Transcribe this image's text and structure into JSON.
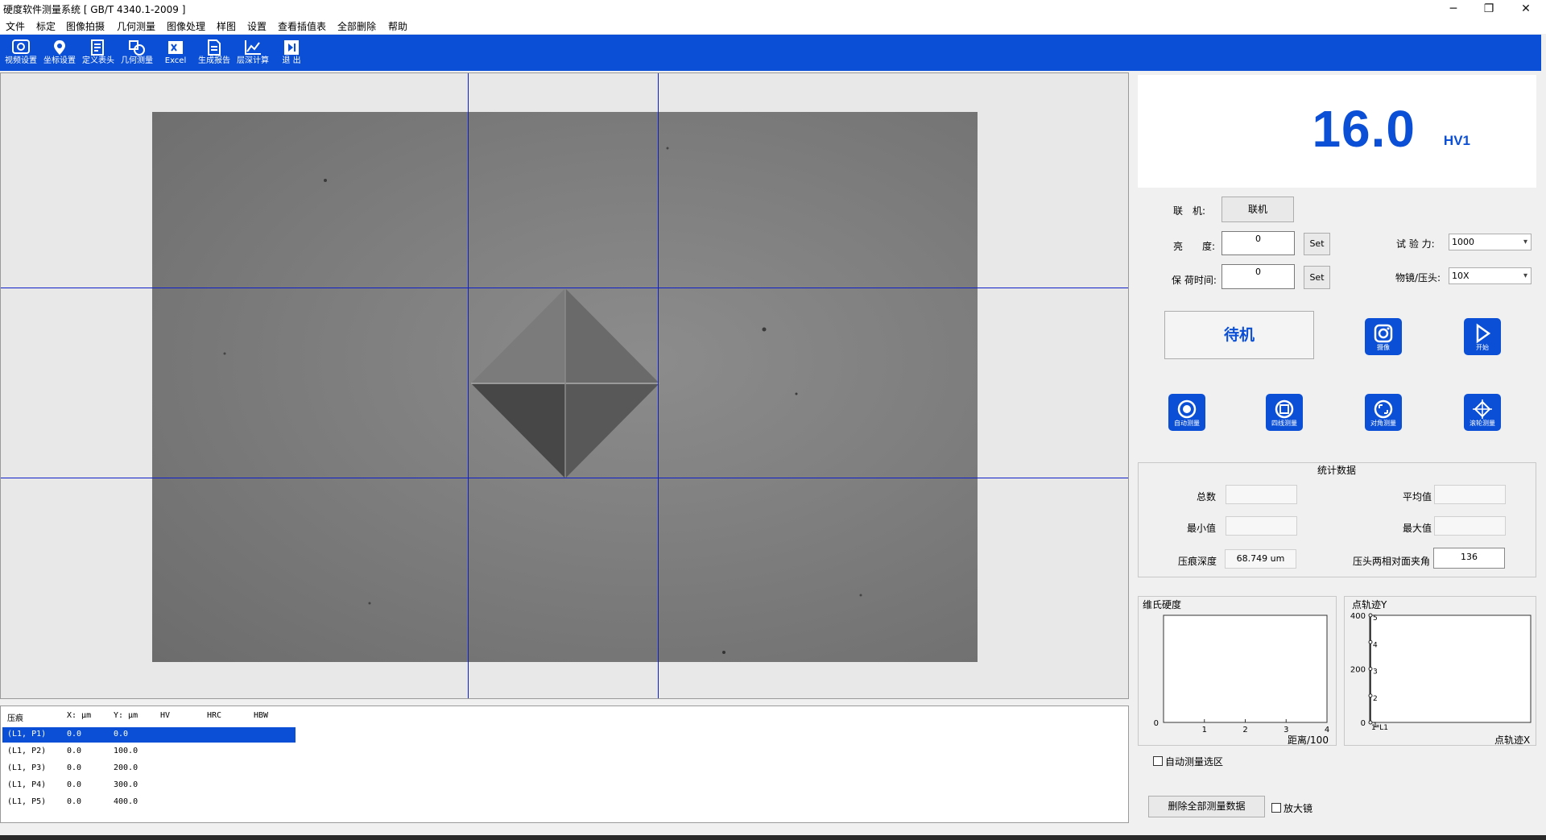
{
  "window": {
    "title": "硬度软件测量系统 [ GB/T 4340.1-2009 ]",
    "minimize": "─",
    "maximize": "❐",
    "close": "✕"
  },
  "menu": [
    "文件",
    "标定",
    "图像拍摄",
    "几何测量",
    "图像处理",
    "样图",
    "设置",
    "查看插值表",
    "全部删除",
    "帮助"
  ],
  "toolbar": [
    {
      "label": "视频设置",
      "icon": "video-settings-icon"
    },
    {
      "label": "坐标设置",
      "icon": "location-pin-icon"
    },
    {
      "label": "定义表头",
      "icon": "edit-document-icon"
    },
    {
      "label": "几何测量",
      "icon": "geometry-icon"
    },
    {
      "label": "Excel",
      "icon": "excel-icon"
    },
    {
      "label": "生成报告",
      "icon": "report-icon"
    },
    {
      "label": "层深计算",
      "icon": "line-chart-icon"
    },
    {
      "label": "退 出",
      "icon": "exit-icon"
    }
  ],
  "table": {
    "headers": [
      "压痕",
      "X: μm",
      "Y: μm",
      "HV",
      "HRC",
      "HBW"
    ],
    "rows": [
      {
        "id": "(L1, P1)",
        "x": "0.0",
        "y": "0.0",
        "selected": true
      },
      {
        "id": "(L1, P2)",
        "x": "0.0",
        "y": "100.0",
        "selected": false
      },
      {
        "id": "(L1, P3)",
        "x": "0.0",
        "y": "200.0",
        "selected": false
      },
      {
        "id": "(L1, P4)",
        "x": "0.0",
        "y": "300.0",
        "selected": false
      },
      {
        "id": "(L1, P5)",
        "x": "0.0",
        "y": "400.0",
        "selected": false
      }
    ]
  },
  "readout": {
    "value": "16.0",
    "unit": "HV1"
  },
  "controls": {
    "connect_label": "联　机:",
    "connect_button": "联机",
    "brightness_label": "亮　　度:",
    "brightness_value": "0",
    "dwell_label": "保 荷时间:",
    "dwell_value": "0",
    "set_button": "Set",
    "force_label": "试 验 力:",
    "force_value": "1000",
    "objective_label": "物镜/压头:",
    "objective_value": "10X",
    "status": "待机"
  },
  "action_buttons": [
    {
      "caption": "摄像",
      "icon": "camera-icon"
    },
    {
      "caption": "开始",
      "icon": "play-icon"
    },
    {
      "caption": "自动测量",
      "icon": "auto-measure-icon"
    },
    {
      "caption": "四线测量",
      "icon": "four-line-measure-icon"
    },
    {
      "caption": "对角测量",
      "icon": "diagonal-measure-icon"
    },
    {
      "caption": "滚轮测量",
      "icon": "wheel-measure-icon"
    }
  ],
  "stats": {
    "title": "统计数据",
    "count_label": "总数",
    "mean_label": "平均值",
    "min_label": "最小值",
    "max_label": "最大值",
    "depth_label": "压痕深度",
    "depth_value": "68.749 um",
    "angle_label": "压头两相对面夹角",
    "angle_value": "136"
  },
  "chart_data": [
    {
      "type": "line",
      "title": "维氏硬度",
      "xlabel": "距离/100",
      "ylabel": "",
      "x_ticks": [
        "1",
        "2",
        "3",
        "4"
      ],
      "y_ticks": [
        "0"
      ],
      "series": []
    },
    {
      "type": "scatter",
      "title": "点轨迹Y",
      "xlabel": "点轨迹X",
      "ylabel": "",
      "y_ticks": [
        "0",
        "200",
        "400"
      ],
      "x_ticks": [
        "1*L1"
      ],
      "points": [
        {
          "x": 0,
          "y": 0,
          "label": "1"
        },
        {
          "x": 0,
          "y": 100,
          "label": "2"
        },
        {
          "x": 0,
          "y": 200,
          "label": "3"
        },
        {
          "x": 0,
          "y": 300,
          "label": "4"
        },
        {
          "x": 0,
          "y": 400,
          "label": "5"
        }
      ],
      "ylim": [
        0,
        400
      ]
    }
  ],
  "checkboxes": {
    "auto_select": "自动测量选区",
    "magnifier": "放大镜"
  },
  "delete_all_button": "删除全部测量数据"
}
